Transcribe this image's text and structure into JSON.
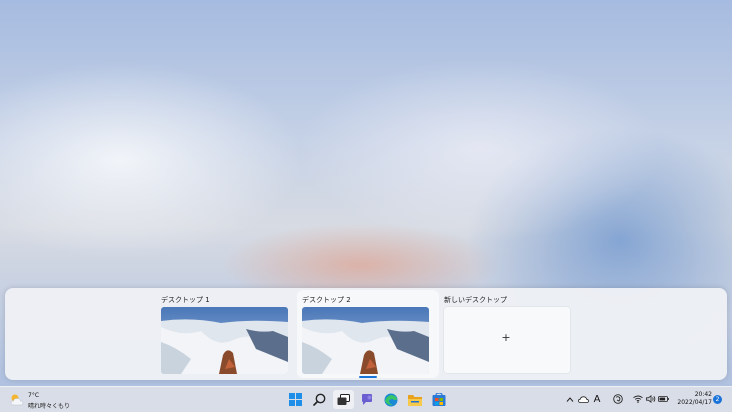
{
  "desktops": [
    {
      "label": "デスクトップ 1",
      "active": false
    },
    {
      "label": "デスクトップ 2",
      "active": true
    }
  ],
  "new_desktop": {
    "label": "新しいデスクトップ",
    "icon": "plus-icon",
    "symbol": "+"
  },
  "weather": {
    "temperature": "7°C",
    "condition": "晴れ時々くもり",
    "icon": "partly-cloudy-icon"
  },
  "taskbar": {
    "icons": [
      "windows-start-icon",
      "search-icon",
      "task-view-icon",
      "teams-chat-icon",
      "edge-browser-icon",
      "file-explorer-icon",
      "store-icon"
    ]
  },
  "tray": {
    "chevron": "^",
    "ime": "A",
    "icons": [
      "chevron-up-icon",
      "onedrive-icon",
      "ime-a-icon",
      "ime-mode-icon",
      "wifi-icon",
      "volume-icon",
      "battery-icon"
    ]
  },
  "clock": {
    "time": "20:42",
    "date": "2022/04/17"
  },
  "notifications": {
    "count": "2"
  },
  "colors": {
    "accent": "#1a73d9",
    "taskbar": "#d9dde7",
    "switcher": "#eef0f5"
  }
}
